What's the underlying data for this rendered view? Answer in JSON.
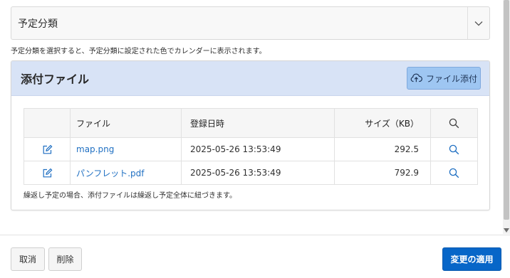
{
  "schedule_category": {
    "value": "予定分類",
    "help": "予定分類を選択すると、予定分類に設定された色でカレンダーに表示されます。"
  },
  "attachments": {
    "title": "添付ファイル",
    "add_button_label": "ファイル添付",
    "columns": {
      "file": "ファイル",
      "registered": "登録日時",
      "size": "サイズ（KB）"
    },
    "rows": [
      {
        "file": "map.png",
        "registered": "2025-05-26 13:53:49",
        "size": "292.5"
      },
      {
        "file": "パンフレット.pdf",
        "registered": "2025-05-26 13:53:49",
        "size": "792.9"
      }
    ],
    "note": "繰返し予定の場合、添付ファイルは繰返し予定全体に紐づきます。"
  },
  "footer": {
    "cancel_label": "取消",
    "delete_label": "削除",
    "apply_label": "変更の適用"
  },
  "colors": {
    "region_header": "#d8e3f6",
    "add_button": "#9ec6f2",
    "link": "#1f6fc2",
    "primary_button": "#0766c8"
  }
}
